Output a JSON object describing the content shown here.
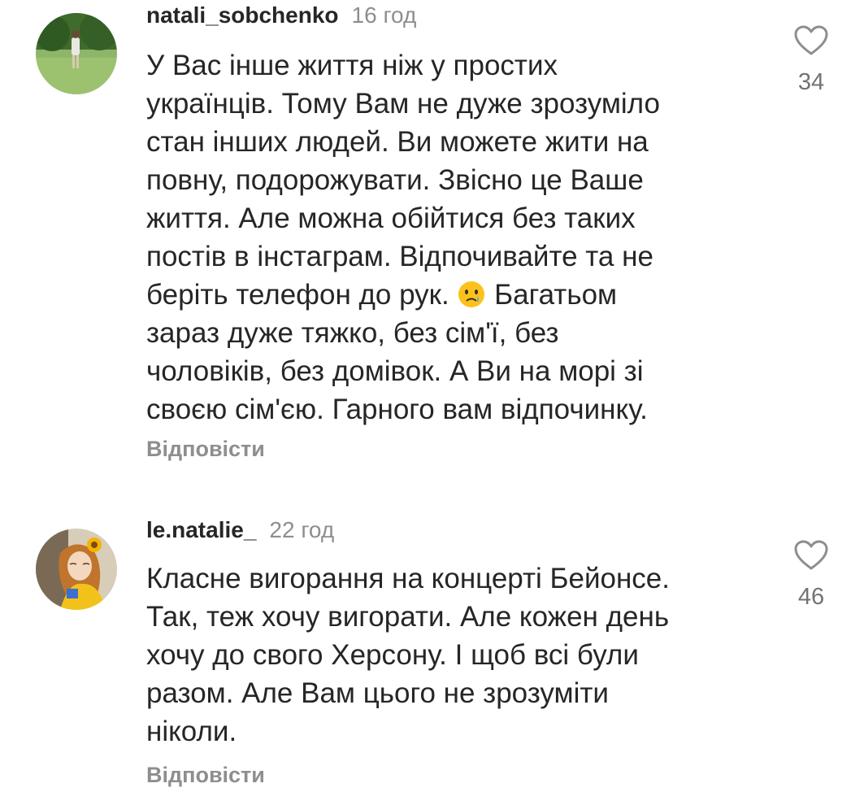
{
  "comments": [
    {
      "username": "natali_sobchenko",
      "time": "16 год",
      "text_lines": [
        "У Вас інше життя ніж у простих",
        "українців. Тому Вам не дуже зрозуміло",
        "стан інших людей. Ви можете жити на",
        "повну, подорожувати. Звісно це Ваше",
        "життя. Але можна обійтися без таких",
        "постів в інстаграм. Відпочивайте та не",
        "беріть телефон до рук.",
        "зараз дуже тяжко, без сім'ї, без",
        "чоловіків, без домівок. А Ви на морі зі",
        "своєю сім'єю. Гарного вам відпочинку."
      ],
      "line7_after_emoji": " Багатьом",
      "emoji": "crying-face-emoji",
      "reply_label": "Відповісти",
      "likes": "34",
      "avatar_icon": "avatar-photo-park"
    },
    {
      "username": "le.natalie_",
      "time": "22 год",
      "text_lines": [
        "Класне вигорання на концерті Бейонсе.",
        "Так, теж хочу вигорати. Але кожен день",
        "хочу до свого Херсону.  І щоб всі були",
        "разом. Але Вам цього не зрозуміти",
        "ніколи."
      ],
      "reply_label": "Відповісти",
      "likes": "46",
      "avatar_icon": "avatar-illustration-sunflower"
    }
  ],
  "colors": {
    "text": "#262626",
    "secondary": "#8e8e8e",
    "like_count": "#737373",
    "heart_outline": "#8e8e8e"
  }
}
